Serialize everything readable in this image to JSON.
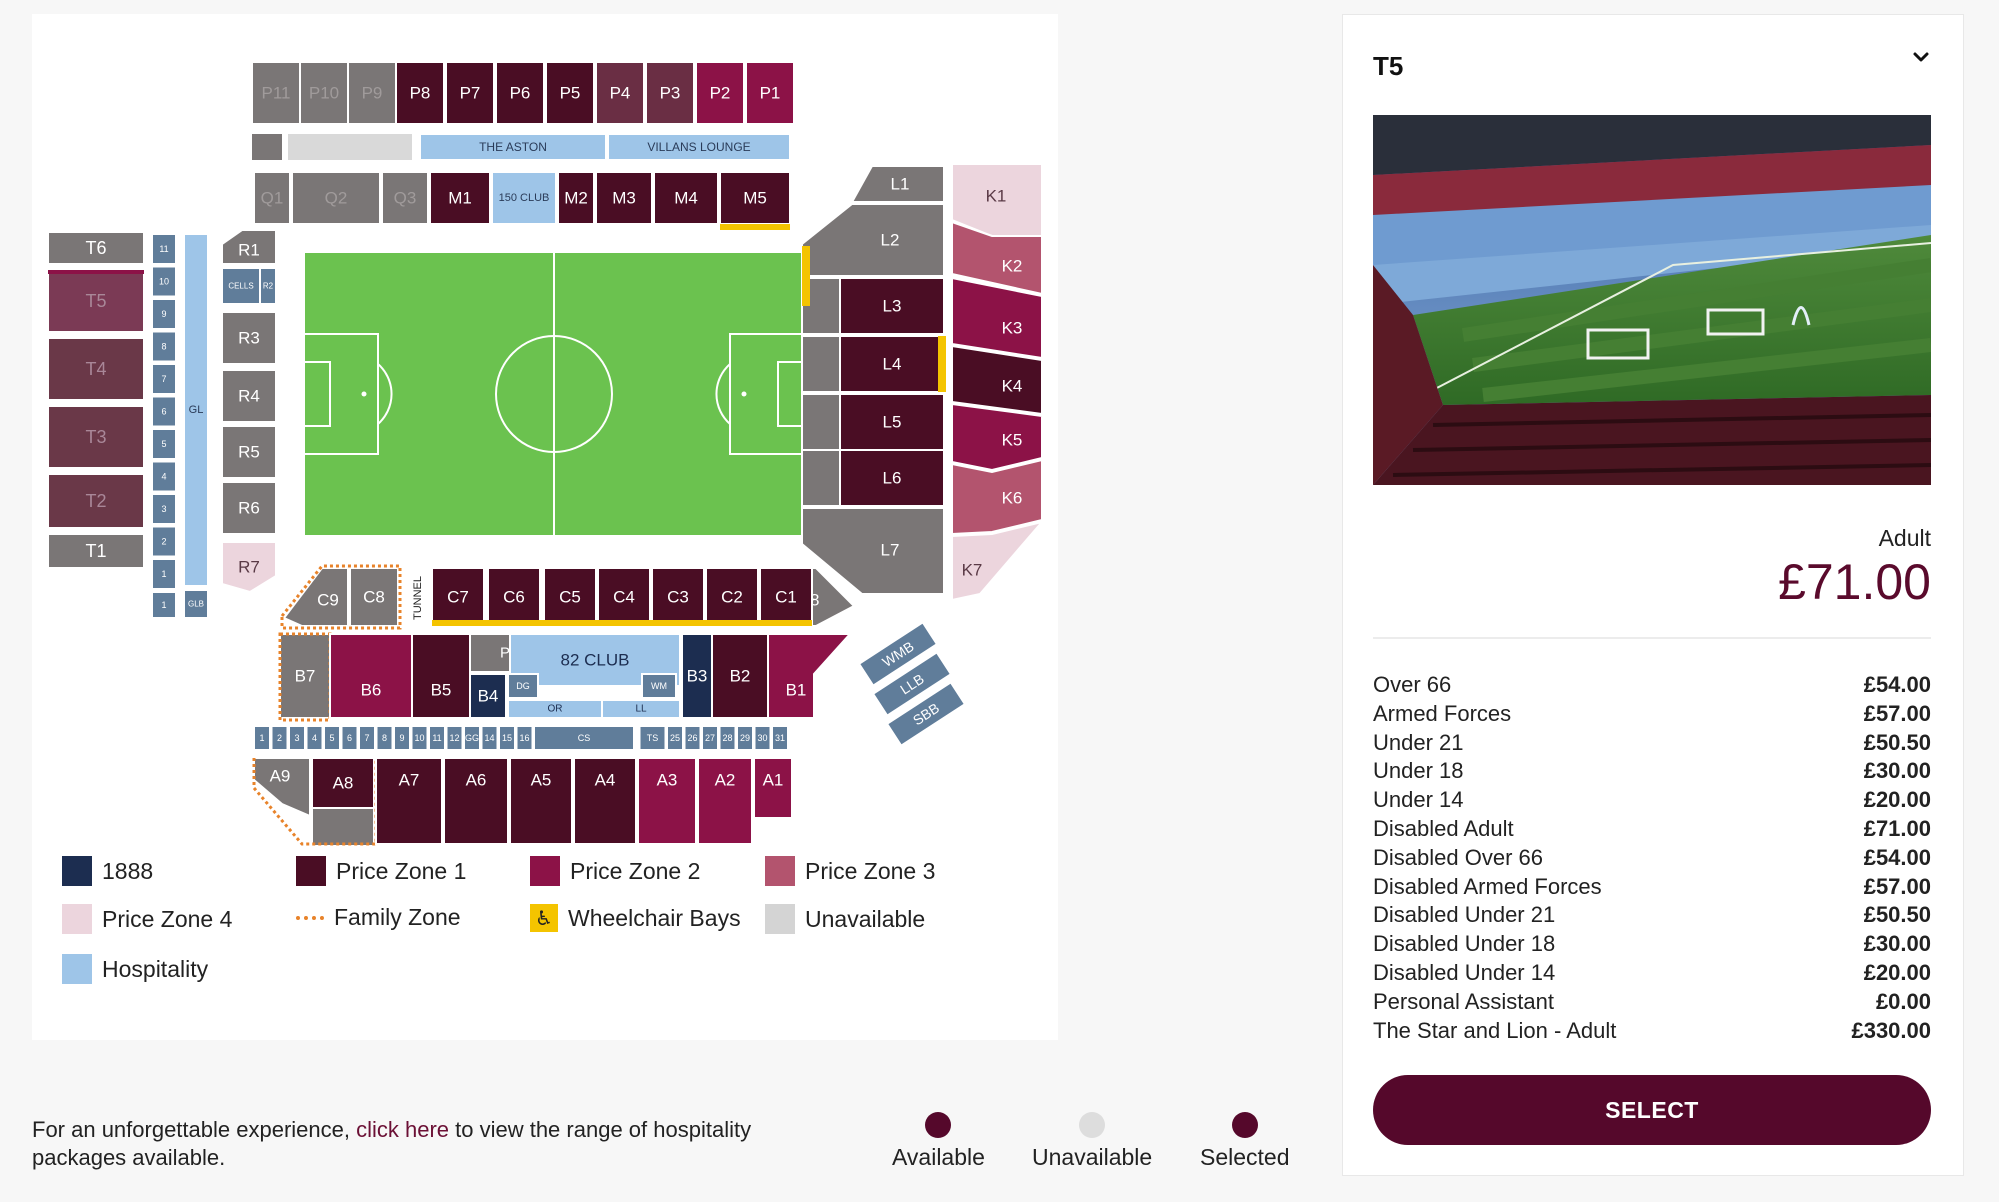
{
  "colors": {
    "c1888": "#1c2d50",
    "zone1": "#4a0d24",
    "zone2": "#8c1247",
    "zone3": "#b3546e",
    "zone4": "#ecd5dd",
    "family": "#e8832a",
    "wheel": "#f4c400",
    "unavail": "#d4d4d4",
    "hosp": "#9ec5e8",
    "pitch": "#6bc24f",
    "brand": "#55082b",
    "available_dot": "#55082b",
    "unavailable_dot": "#dddddd",
    "selected_dot": "#55082b"
  },
  "map": {
    "top_labels": [
      "P11",
      "P10",
      "P9",
      "P8",
      "P7",
      "P6",
      "P5",
      "P4",
      "P3",
      "P2",
      "P1"
    ],
    "aston": "THE ASTON",
    "villans": "VILLANS LOUNGE",
    "mid_labels": [
      "Q1",
      "Q2",
      "Q3",
      "M1",
      "150 CLUB",
      "M2",
      "M3",
      "M4",
      "M5"
    ],
    "west_labels": [
      "T6",
      "T5",
      "T4",
      "T3",
      "T2",
      "T1"
    ],
    "gl": "GL",
    "glb": "GLB",
    "west_numbers": [
      "11",
      "10",
      "9",
      "8",
      "7",
      "6",
      "5",
      "4",
      "3",
      "2",
      "1"
    ],
    "r_labels": [
      "R1",
      "CELLS",
      "R2",
      "R3",
      "R4",
      "R5",
      "R6",
      "R7"
    ],
    "l_labels": [
      "L1",
      "L2",
      "L3",
      "L4",
      "L5",
      "L6",
      "L7",
      "L8"
    ],
    "k_labels": [
      "K1",
      "K2",
      "K3",
      "K4",
      "K5",
      "K6",
      "K7"
    ],
    "c_labels": [
      "C9",
      "C8",
      "C7",
      "C6",
      "C5",
      "C4",
      "C3",
      "C2",
      "C1"
    ],
    "tunnel": "TUNNEL",
    "pb": "PB",
    "club82": "82 CLUB",
    "b_labels": [
      "B7",
      "B6",
      "B5",
      "B4",
      "DG",
      "WM",
      "B3",
      "B2",
      "B1"
    ],
    "or": "OR",
    "ll": "LL",
    "wmb": "WMB",
    "llb": "LLB",
    "sbb": "SBB",
    "bottom_numbers": [
      "1",
      "2",
      "3",
      "4",
      "5",
      "6",
      "7",
      "8",
      "9",
      "10",
      "11",
      "12",
      "GG",
      "14",
      "15",
      "16",
      "CS",
      "TS",
      "25",
      "26",
      "27",
      "28",
      "29",
      "30",
      "31"
    ],
    "a_labels": [
      "A9",
      "A8",
      "A7",
      "A6",
      "A5",
      "A4",
      "A3",
      "A2",
      "A1"
    ]
  },
  "legend": [
    {
      "label": "1888",
      "color": "c1888"
    },
    {
      "label": "Price Zone 1",
      "color": "zone1"
    },
    {
      "label": "Price Zone 2",
      "color": "zone2"
    },
    {
      "label": "Price Zone 3",
      "color": "zone3"
    },
    {
      "label": "Price Zone 4",
      "color": "zone4"
    },
    {
      "label": "Family Zone",
      "color": "family"
    },
    {
      "label": "Wheelchair Bays",
      "color": "wheel"
    },
    {
      "label": "Unavailable",
      "color": "unavail"
    },
    {
      "label": "Hospitality",
      "color": "hosp"
    }
  ],
  "wheel_icon": "wheelchair-icon",
  "hospitality": {
    "before": "For an unforgettable experience, ",
    "link": "click here",
    "after": " to view the range of hospitality packages available."
  },
  "status": {
    "available": "Available",
    "unavailable": "Unavailable",
    "selected": "Selected"
  },
  "panel": {
    "title": "T5",
    "chevron_icon": "chevron-down-icon",
    "photo_icon": "stadium-photo",
    "adult_label": "Adult",
    "adult_price": "£71.00",
    "prices": [
      {
        "label": "Over 66",
        "amount": "£54.00"
      },
      {
        "label": "Armed Forces",
        "amount": "£57.00"
      },
      {
        "label": "Under 21",
        "amount": "£50.50"
      },
      {
        "label": "Under 18",
        "amount": "£30.00"
      },
      {
        "label": "Under 14",
        "amount": "£20.00"
      },
      {
        "label": "Disabled Adult",
        "amount": "£71.00"
      },
      {
        "label": "Disabled Over 66",
        "amount": "£54.00"
      },
      {
        "label": "Disabled Armed Forces",
        "amount": "£57.00"
      },
      {
        "label": "Disabled Under 21",
        "amount": "£50.50"
      },
      {
        "label": "Disabled Under 18",
        "amount": "£30.00"
      },
      {
        "label": "Disabled Under 14",
        "amount": "£20.00"
      },
      {
        "label": "Personal Assistant",
        "amount": "£0.00"
      },
      {
        "label": "The Star and Lion - Adult",
        "amount": "£330.00"
      }
    ],
    "select_label": "SELECT"
  }
}
